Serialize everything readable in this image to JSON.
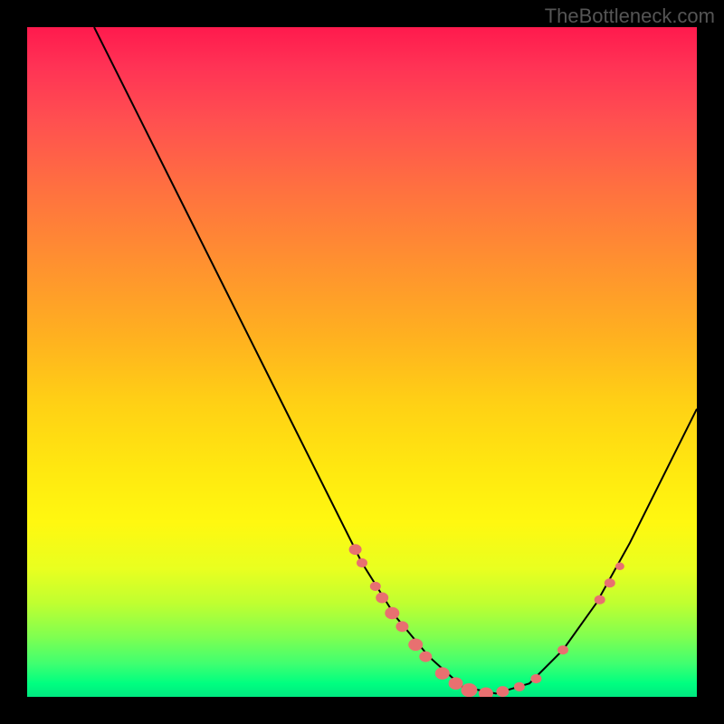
{
  "watermark": "TheBottleneck.com",
  "chart_data": {
    "type": "line",
    "title": "",
    "xlabel": "",
    "ylabel": "",
    "background_gradient": {
      "top": "#ff1a4d",
      "bottom": "#00e880"
    },
    "curve": {
      "description": "V-shaped bottleneck curve descending from top-left, reaching minimum around x=0.67, then ascending to right",
      "points_normalized": [
        {
          "x": 0.1,
          "y": 0.0
        },
        {
          "x": 0.15,
          "y": 0.1
        },
        {
          "x": 0.2,
          "y": 0.2
        },
        {
          "x": 0.25,
          "y": 0.3
        },
        {
          "x": 0.3,
          "y": 0.4
        },
        {
          "x": 0.35,
          "y": 0.5
        },
        {
          "x": 0.4,
          "y": 0.6
        },
        {
          "x": 0.45,
          "y": 0.7
        },
        {
          "x": 0.5,
          "y": 0.8
        },
        {
          "x": 0.55,
          "y": 0.88
        },
        {
          "x": 0.6,
          "y": 0.94
        },
        {
          "x": 0.65,
          "y": 0.985
        },
        {
          "x": 0.7,
          "y": 0.995
        },
        {
          "x": 0.75,
          "y": 0.98
        },
        {
          "x": 0.8,
          "y": 0.93
        },
        {
          "x": 0.85,
          "y": 0.86
        },
        {
          "x": 0.9,
          "y": 0.77
        },
        {
          "x": 0.95,
          "y": 0.67
        },
        {
          "x": 1.0,
          "y": 0.57
        }
      ]
    },
    "scatter_points_normalized": [
      {
        "x": 0.49,
        "y": 0.78,
        "r": 7
      },
      {
        "x": 0.5,
        "y": 0.8,
        "r": 6
      },
      {
        "x": 0.52,
        "y": 0.835,
        "r": 6
      },
      {
        "x": 0.53,
        "y": 0.852,
        "r": 7
      },
      {
        "x": 0.545,
        "y": 0.875,
        "r": 8
      },
      {
        "x": 0.56,
        "y": 0.895,
        "r": 7
      },
      {
        "x": 0.58,
        "y": 0.922,
        "r": 8
      },
      {
        "x": 0.595,
        "y": 0.94,
        "r": 7
      },
      {
        "x": 0.62,
        "y": 0.965,
        "r": 8
      },
      {
        "x": 0.64,
        "y": 0.98,
        "r": 8
      },
      {
        "x": 0.66,
        "y": 0.99,
        "r": 9
      },
      {
        "x": 0.685,
        "y": 0.995,
        "r": 8
      },
      {
        "x": 0.71,
        "y": 0.992,
        "r": 7
      },
      {
        "x": 0.735,
        "y": 0.985,
        "r": 6
      },
      {
        "x": 0.76,
        "y": 0.973,
        "r": 6
      },
      {
        "x": 0.8,
        "y": 0.93,
        "r": 6
      },
      {
        "x": 0.855,
        "y": 0.855,
        "r": 6
      },
      {
        "x": 0.87,
        "y": 0.83,
        "r": 6
      },
      {
        "x": 0.885,
        "y": 0.805,
        "r": 5
      }
    ]
  }
}
